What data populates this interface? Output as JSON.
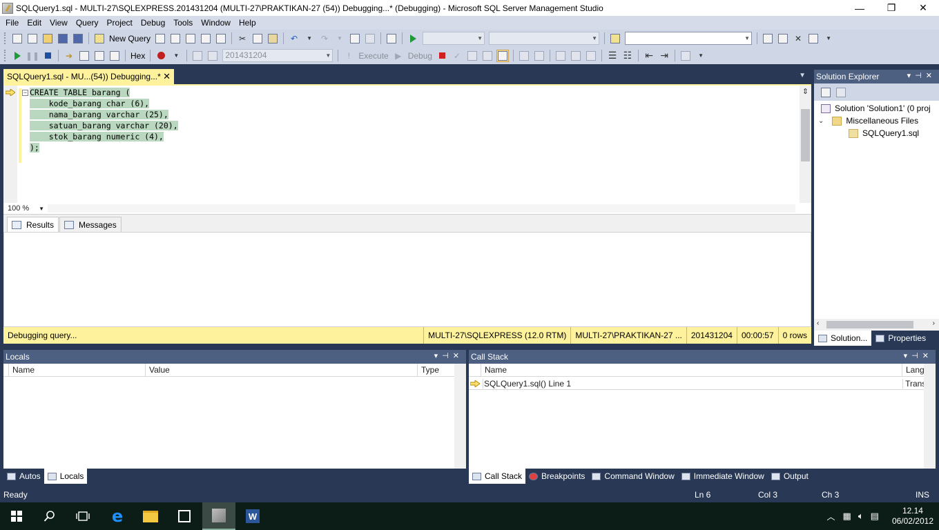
{
  "window": {
    "title": "SQLQuery1.sql - MULTI-27\\SQLEXPRESS.201431204 (MULTI-27\\PRAKTIKAN-27 (54)) Debugging...* (Debugging) - Microsoft SQL Server Management Studio",
    "minimize": "—",
    "maximize": "❐",
    "close": "✕"
  },
  "menu": [
    "File",
    "Edit",
    "View",
    "Query",
    "Project",
    "Debug",
    "Tools",
    "Window",
    "Help"
  ],
  "toolbar1": {
    "new_query_label": "New Query",
    "search_value": ""
  },
  "toolbar2": {
    "hex_label": "Hex",
    "database_value": "201431204",
    "execute_label": "Execute",
    "debug_label": "Debug"
  },
  "document": {
    "tab_label": "SQLQuery1.sql - MU...(54)) Debugging...*",
    "tab_close": "✕",
    "code_lines": [
      "CREATE TABLE barang (",
      "    kode_barang char (6),",
      "    nama_barang varchar (25),",
      "    satuan_barang varchar (20),",
      "    stok_barang numeric (4),",
      ");"
    ],
    "zoom": "100 %"
  },
  "results": {
    "tab_results": "Results",
    "tab_messages": "Messages"
  },
  "query_status": {
    "message": "Debugging query...",
    "server": "MULTI-27\\SQLEXPRESS (12.0 RTM)",
    "user": "MULTI-27\\PRAKTIKAN-27 ...",
    "database": "201431204",
    "elapsed": "00:00:57",
    "rows": "0 rows"
  },
  "solution_explorer": {
    "title": "Solution Explorer",
    "solution": "Solution 'Solution1' (0 proj",
    "folder": "Miscellaneous Files",
    "file": "SQLQuery1.sql",
    "tab_solution": "Solution...",
    "tab_properties": "Properties"
  },
  "locals": {
    "title": "Locals",
    "columns": [
      "Name",
      "Value",
      "Type"
    ],
    "tab_autos": "Autos",
    "tab_locals": "Locals"
  },
  "callstack": {
    "title": "Call Stack",
    "columns": [
      "Name",
      "Lang"
    ],
    "rows": [
      {
        "name": "SQLQuery1.sql() Line 1",
        "lang": "Trans"
      }
    ],
    "tabs": [
      "Call Stack",
      "Breakpoints",
      "Command Window",
      "Immediate Window",
      "Output"
    ]
  },
  "statusbar": {
    "ready": "Ready",
    "ln": "Ln 6",
    "col": "Col 3",
    "ch": "Ch 3",
    "ins": "INS"
  },
  "taskbar": {
    "time": "12.14",
    "date": "06/02/2012"
  }
}
